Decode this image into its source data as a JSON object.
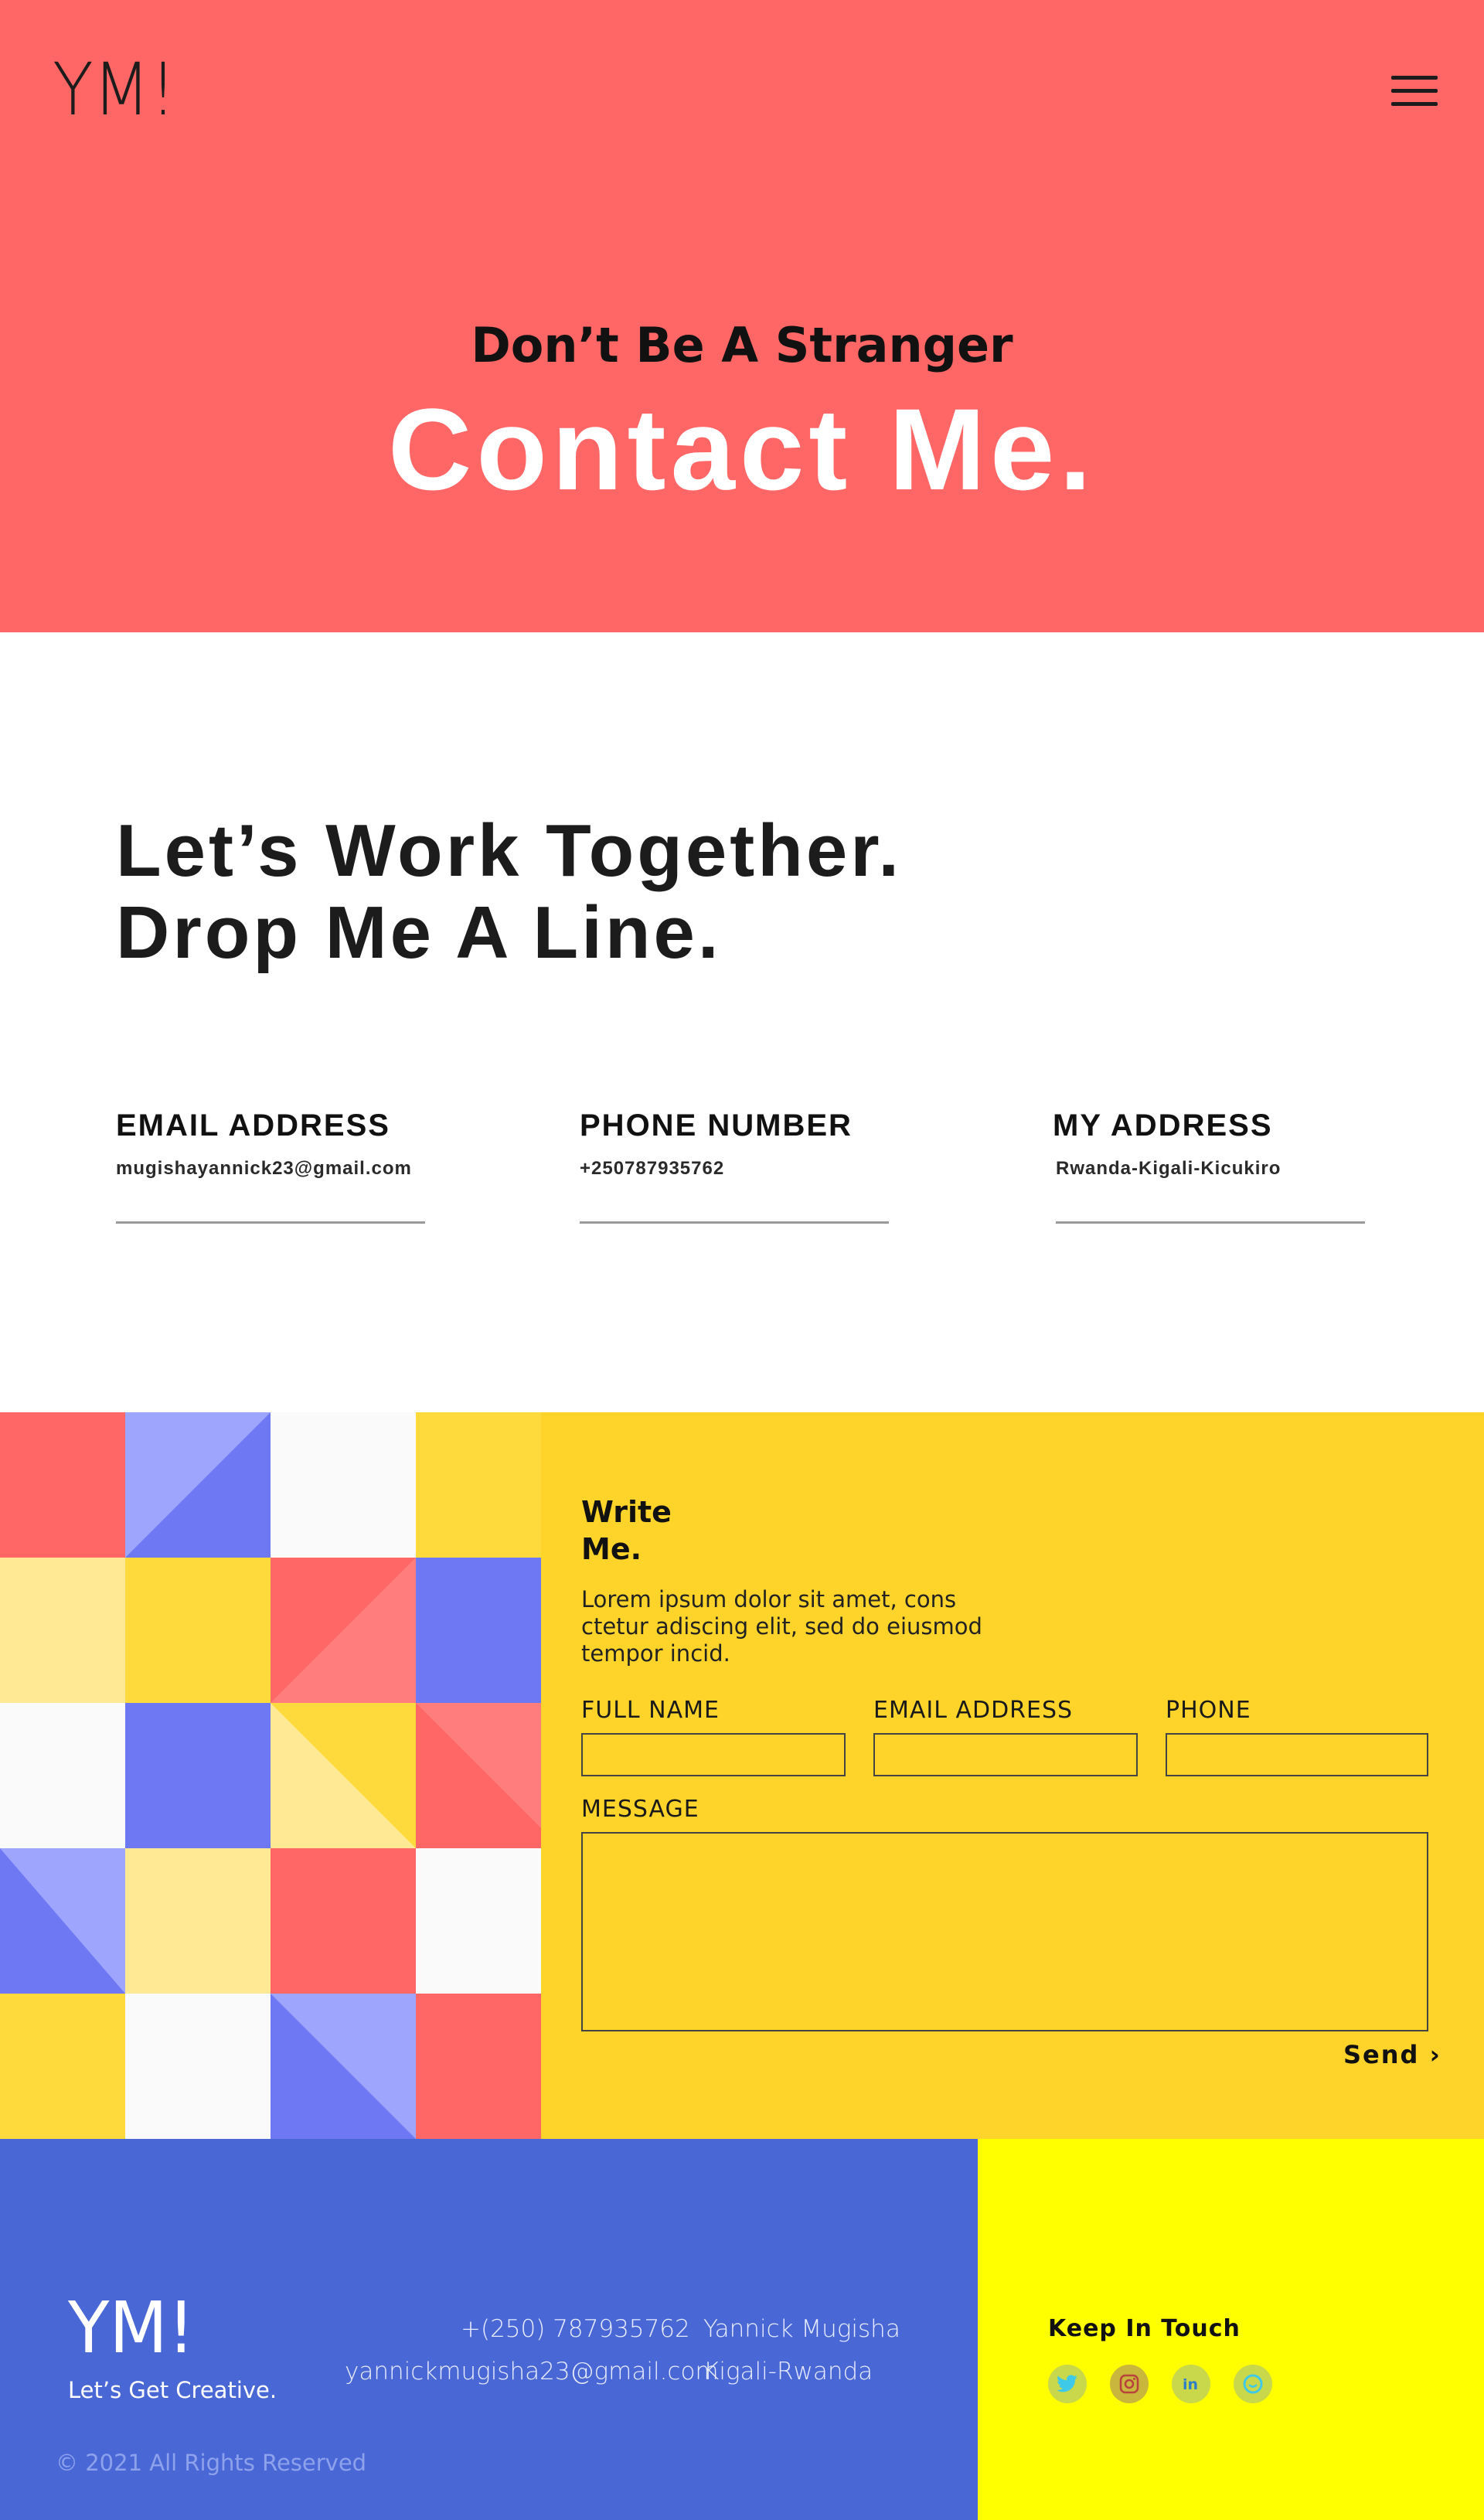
{
  "header": {
    "logo": "YM!"
  },
  "hero": {
    "subtitle": "Don’t Be A Stranger",
    "title": "Contact Me."
  },
  "intro": {
    "line1": "Let’s Work Together.",
    "line2": "Drop Me A Line."
  },
  "contact_info": [
    {
      "label": "EMAIL ADDRESS",
      "value": "mugishayannick23@gmail.com"
    },
    {
      "label": "PHONE NUMBER",
      "value": "+250787935762"
    },
    {
      "label": "MY ADDRESS",
      "value": "Rwanda-Kigali-Kicukiro"
    }
  ],
  "form": {
    "title_line1": "Write",
    "title_line2": "Me.",
    "description": "Lorem ipsum dolor sit amet, cons ctetur adiscing elit, sed do eiusmod tempor incid.",
    "full_name_label": "FULL NAME",
    "email_label": "EMAIL ADDRESS",
    "phone_label": "PHONE",
    "message_label": "MESSAGE",
    "send_label": "Send ›"
  },
  "footer": {
    "logo": "YM!",
    "tagline": "Let’s Get Creative.",
    "phone": "+(250) 787935762",
    "email": "yannickmugisha23@gmail.com",
    "name": "Yannick Mugisha",
    "location": "Kigali-Rwanda",
    "copyright": "© 2021 All Rights Reserved",
    "keep_in_touch": "Keep In Touch",
    "social_icons": [
      "twitter-icon",
      "instagram-icon",
      "linkedin-icon",
      "github-icon"
    ]
  },
  "colors": {
    "hero_bg": "#ff6666",
    "form_bg": "#ffd42a",
    "footer_blue": "#4a67d6",
    "footer_yellow": "#ffff00",
    "mosaic_red": "#ff6666",
    "mosaic_blue": "#6f78f3",
    "mosaic_lightblue": "#9da5fc",
    "mosaic_yellow": "#ffda3d",
    "mosaic_paleyellow": "#ffe994",
    "mosaic_white": "#fafafa"
  }
}
